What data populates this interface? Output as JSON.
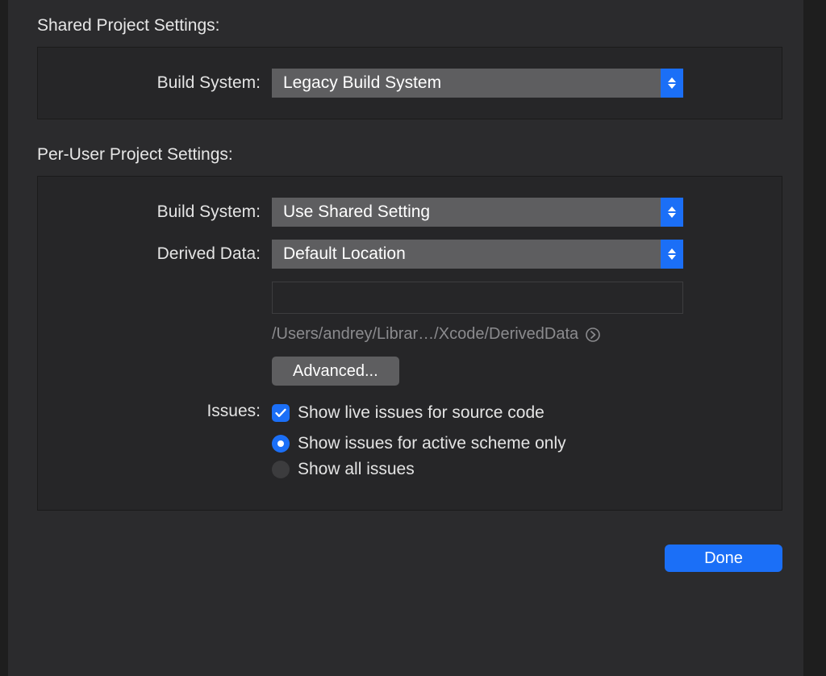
{
  "shared": {
    "title": "Shared Project Settings:",
    "build_system_label": "Build System:",
    "build_system_value": "Legacy Build System"
  },
  "per_user": {
    "title": "Per-User Project Settings:",
    "build_system_label": "Build System:",
    "build_system_value": "Use Shared Setting",
    "derived_data_label": "Derived Data:",
    "derived_data_value": "Default Location",
    "derived_data_path": "/Users/andrey/Librar…/Xcode/DerivedData",
    "advanced_label": "Advanced...",
    "issues_label": "Issues:",
    "checkbox_live_issues": "Show live issues for source code",
    "checkbox_live_issues_checked": true,
    "radio_active_scheme": "Show issues for active scheme only",
    "radio_all_issues": "Show all issues",
    "radio_selected": "active_scheme"
  },
  "footer": {
    "done_label": "Done"
  }
}
